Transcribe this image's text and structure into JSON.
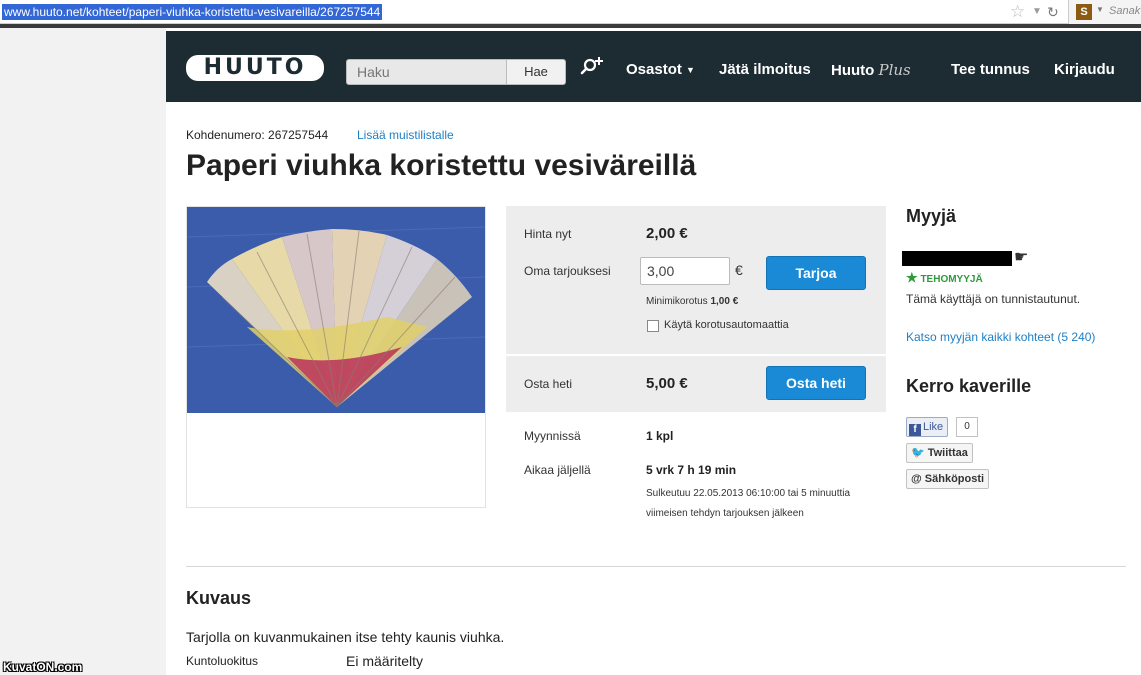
{
  "browser": {
    "url": "www.huuto.net/kohteet/paperi-viuhka-koristettu-vesivareilla/267257544",
    "addon_label": "Sanak"
  },
  "watermark": "KuvatON.com",
  "header": {
    "logo_text": "HUUTO",
    "search_placeholder": "Haku",
    "search_button": "Hae",
    "nav": {
      "departments": "Osastot",
      "post_listing": "Jätä ilmoitus",
      "huuto": "Huuto",
      "plus": "Plus",
      "register": "Tee tunnus",
      "login": "Kirjaudu"
    }
  },
  "item": {
    "number_label": "Kohdenumero: 267257544",
    "watchlist_link": "Lisää muistilistalle",
    "title": "Paperi viuhka koristettu vesiväreillä",
    "photo_caption": "Paper fan"
  },
  "buybox": {
    "current_price_label": "Hinta nyt",
    "current_price": "2,00 €",
    "your_bid_label": "Oma tarjouksesi",
    "bid_value": "3,00",
    "currency": "€",
    "bid_button": "Tarjoa",
    "min_increase_label": "Minimikorotus",
    "min_increase_value": "1,00 €",
    "auto_bid_label": "Käytä korotusautomaattia",
    "buy_now_label": "Osta heti",
    "buy_now_price": "5,00 €",
    "buy_now_button": "Osta heti"
  },
  "details": {
    "quantity_label": "Myynnissä",
    "quantity_value": "1 kpl",
    "time_left_label": "Aikaa jäljellä",
    "time_left_value": "5 vrk 7 h 19 min",
    "closing_text": "Sulkeutuu 22.05.2013 06:10:00 tai 5 minuuttia viimeisen tehdyn tarjouksen jälkeen"
  },
  "seller": {
    "heading": "Myyjä",
    "power_seller": "TEHOMYYJÄ",
    "verified_text": "Tämä käyttäjä on tunnistautunut.",
    "all_items_link": "Katso myyjän kaikki kohteet (5 240)"
  },
  "share": {
    "heading": "Kerro kaverille",
    "fb_like": "Like",
    "fb_count": "0",
    "tweet": "Twiittaa",
    "email": "@ Sähköposti"
  },
  "description": {
    "heading": "Kuvaus",
    "text": "Tarjolla on kuvanmukainen itse tehty kaunis viuhka.",
    "condition_label": "Kuntoluokitus",
    "condition_value": "Ei määritelty"
  },
  "colors": {
    "nav_bg": "#1d2b33",
    "accent_blue": "#1a8ad6",
    "link": "#1f7fc5",
    "power_green": "#2e9a3c"
  }
}
